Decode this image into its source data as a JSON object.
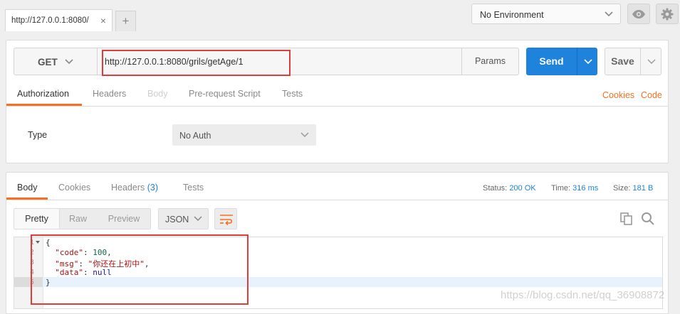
{
  "tab": {
    "title": "http://127.0.0.1:8080/",
    "close": "×",
    "add": "+"
  },
  "environment": {
    "selected": "No Environment"
  },
  "request": {
    "method": "GET",
    "url": "http://127.0.0.1:8080/grils/getAge/1",
    "params_label": "Params",
    "send_label": "Send",
    "save_label": "Save",
    "tabs": [
      "Authorization",
      "Headers",
      "Body",
      "Pre-request Script",
      "Tests"
    ],
    "cookies_link": "Cookies",
    "code_link": "Code",
    "auth": {
      "label": "Type",
      "value": "No Auth"
    }
  },
  "response": {
    "tabs": [
      "Body",
      "Cookies",
      "Headers",
      "Tests"
    ],
    "headers_count": "(3)",
    "status_label": "Status:",
    "status_value": "200 OK",
    "time_label": "Time:",
    "time_value": "316 ms",
    "size_label": "Size:",
    "size_value": "181 B",
    "view_modes": [
      "Pretty",
      "Raw",
      "Preview"
    ],
    "format": "JSON",
    "line_numbers": [
      "1",
      "2",
      "3",
      "4",
      "5"
    ],
    "body": {
      "open": "{",
      "k_code": "\"code\"",
      "v_code": "100",
      "k_msg": "\"msg\"",
      "v_msg": "\"你还在上初中\"",
      "k_data": "\"data\"",
      "v_data": "null",
      "close": "}"
    }
  },
  "watermark": "https://blog.csdn.net/qq_36908872",
  "colors": {
    "accent_blue": "#1f83dc",
    "accent_orange": "#f47023",
    "annotation_red": "#e03c3c"
  }
}
